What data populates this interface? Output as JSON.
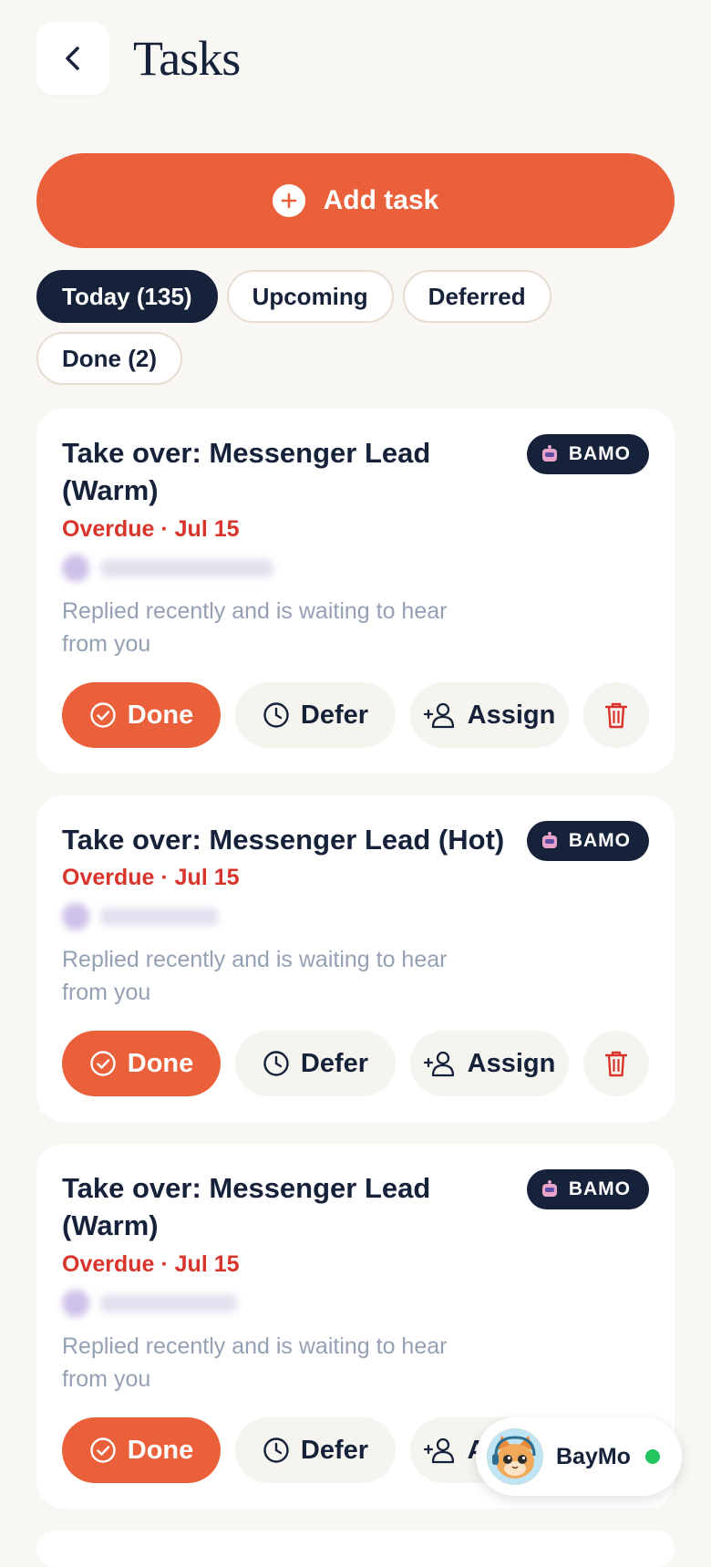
{
  "header": {
    "title": "Tasks",
    "back_icon": "chevron-left-icon"
  },
  "add_task": {
    "label": "Add task",
    "icon": "plus-circle-icon"
  },
  "filters": [
    {
      "label": "Today (135)",
      "active": true
    },
    {
      "label": "Upcoming",
      "active": false
    },
    {
      "label": "Deferred",
      "active": false
    },
    {
      "label": "Done (2)",
      "active": false
    }
  ],
  "tasks": [
    {
      "title": "Take over: Messenger Lead (Warm)",
      "badge": "BAMO",
      "due": "Overdue · Jul 15",
      "description": "Replied recently and is waiting to hear from you"
    },
    {
      "title": "Take over: Messenger Lead (Hot)",
      "badge": "BAMO",
      "due": "Overdue · Jul 15",
      "description": "Replied recently and is waiting to hear from you"
    },
    {
      "title": "Take over: Messenger Lead (Warm)",
      "badge": "BAMO",
      "due": "Overdue · Jul 15",
      "description": "Replied recently and is waiting to hear from you"
    }
  ],
  "actions": {
    "done": "Done",
    "defer": "Defer",
    "assign": "Assign"
  },
  "assistant": {
    "name": "BayMo",
    "status": "online"
  },
  "colors": {
    "accent": "#E9603A",
    "navy": "#16213A",
    "overdue": "#D9342B",
    "online": "#22C55E"
  }
}
